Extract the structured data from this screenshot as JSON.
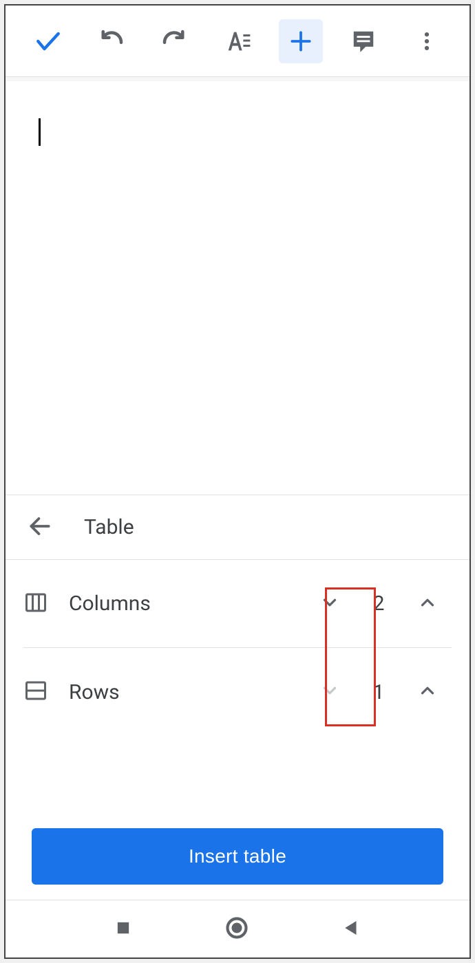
{
  "sheet": {
    "title": "Table",
    "columns_label": "Columns",
    "rows_label": "Rows",
    "columns_value": "2",
    "rows_value": "1",
    "insert_label": "Insert table"
  }
}
